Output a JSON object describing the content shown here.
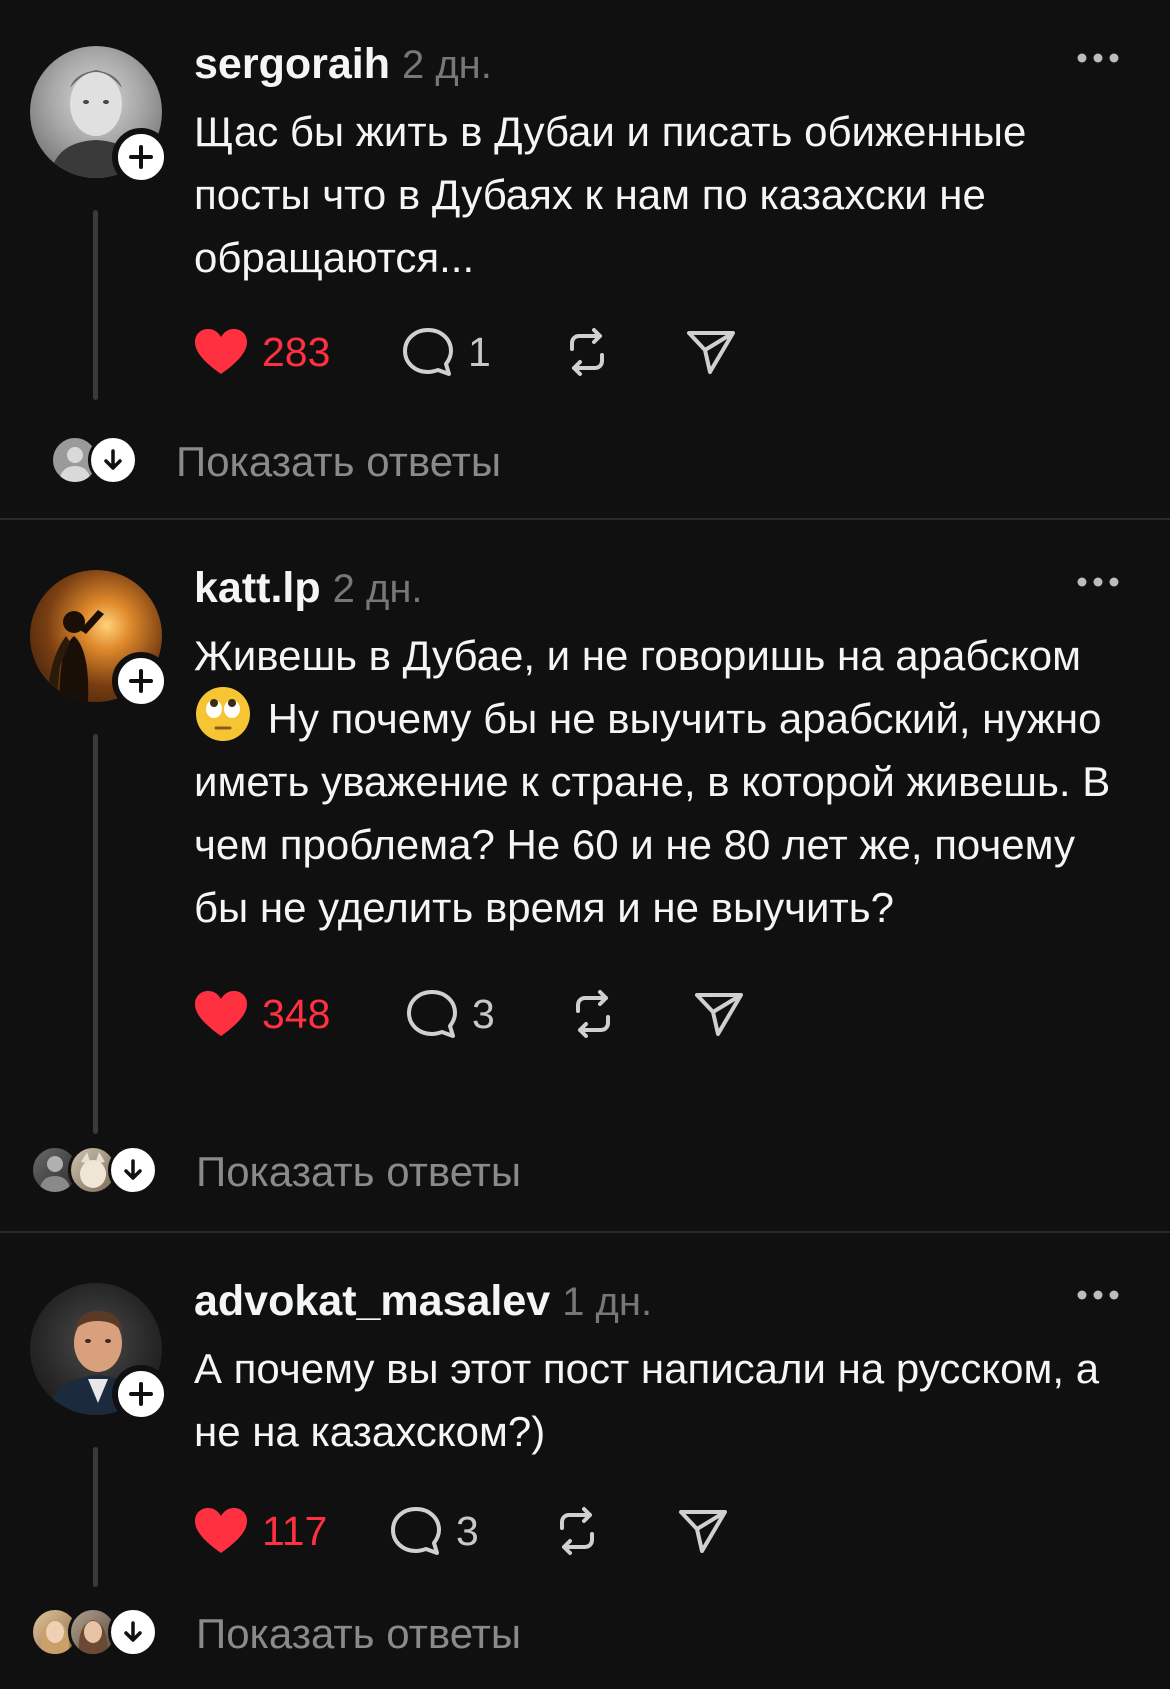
{
  "posts": [
    {
      "username": "sergoraih",
      "time": "2 дн.",
      "text": "Щас бы жить в Дубаи и писать обиженные посты что в Дубаях к нам по казахски не обращаются...",
      "likes": "283",
      "replies": "1",
      "show_replies": "Показать ответы"
    },
    {
      "username": "katt.lp",
      "time": "2 дн.",
      "text_part1": "Живешь в Дубае, и не говоришь на арабском",
      "text_part2": " Ну почему бы не выучить арабский, нужно иметь уважение к стране, в которой живешь. В чем проблема? Не 60 и не 80 лет же, почему бы не уделить время и не выучить?",
      "likes": "348",
      "replies": "3",
      "show_replies": "Показать ответы"
    },
    {
      "username": "advokat_masalev",
      "time": "1 дн.",
      "text": "А почему вы этот пост написали на русском, а не на казахском?)",
      "likes": "117",
      "replies": "3",
      "show_replies": "Показать ответы"
    }
  ],
  "icons": {
    "like": "heart-icon",
    "reply": "comment-icon",
    "repost": "repost-icon",
    "share": "send-icon",
    "more": "more-icon",
    "follow": "plus-icon",
    "expand": "arrow-down-icon"
  },
  "colors": {
    "background": "#101010",
    "like_red": "#ff3040",
    "secondary_text": "#8a8a8a"
  }
}
